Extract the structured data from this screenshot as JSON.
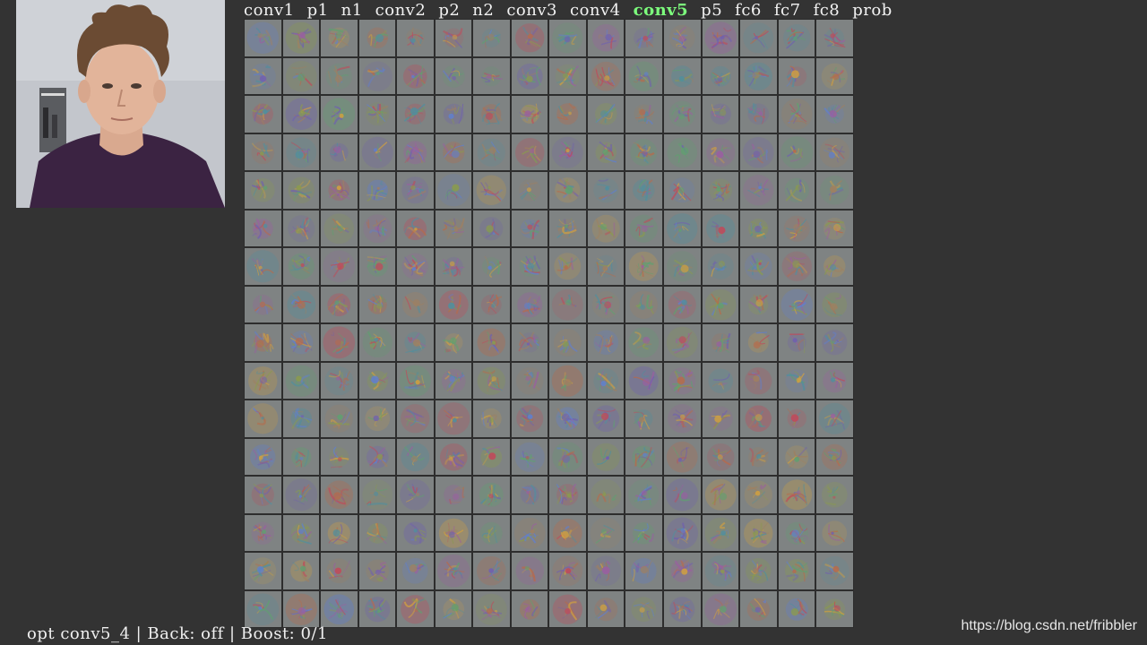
{
  "layers": [
    {
      "label": "conv1",
      "active": false
    },
    {
      "label": "p1",
      "active": false
    },
    {
      "label": "n1",
      "active": false
    },
    {
      "label": "conv2",
      "active": false
    },
    {
      "label": "p2",
      "active": false
    },
    {
      "label": "n2",
      "active": false
    },
    {
      "label": "conv3",
      "active": false
    },
    {
      "label": "conv4",
      "active": false
    },
    {
      "label": "conv5",
      "active": true
    },
    {
      "label": "p5",
      "active": false
    },
    {
      "label": "fc6",
      "active": false
    },
    {
      "label": "fc7",
      "active": false
    },
    {
      "label": "fc8",
      "active": false
    },
    {
      "label": "prob",
      "active": false
    }
  ],
  "status": {
    "text": "opt conv5_4 | Back: off | Boost: 0/1"
  },
  "watermark": "https://blog.csdn.net/fribbler",
  "grid": {
    "rows": 16,
    "cols": 16
  },
  "colors": {
    "background": "#333333",
    "active_layer": "#7dff7d",
    "text": "#f2f2f2",
    "cell_gray": "#7f8383"
  }
}
